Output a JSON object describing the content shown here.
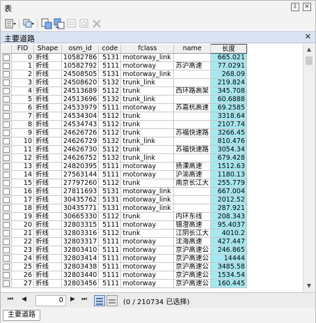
{
  "window": {
    "title": "表"
  },
  "table_tab": {
    "name": "主要道路"
  },
  "columns": [
    "FID",
    "Shape",
    "osm_id",
    "code",
    "fclass",
    "name",
    "长度"
  ],
  "rows": [
    [
      "0",
      "折线",
      "10582786",
      "5131",
      "motorway_link",
      "",
      "665.021"
    ],
    [
      "1",
      "折线",
      "10582792",
      "5111",
      "motorway",
      "苏沪高速",
      "77.0291"
    ],
    [
      "2",
      "折线",
      "24508505",
      "5131",
      "motorway_link",
      "",
      "268.09"
    ],
    [
      "3",
      "折线",
      "24508620",
      "5132",
      "trunk_link",
      "",
      "219.824"
    ],
    [
      "4",
      "折线",
      "24513689",
      "5112",
      "trunk",
      "西环路高架",
      "345.708"
    ],
    [
      "5",
      "折线",
      "24513696",
      "5132",
      "trunk_link",
      "",
      "60.6888"
    ],
    [
      "6",
      "折线",
      "24533979",
      "5111",
      "motorway",
      "苏嘉杭高速",
      "69.2585"
    ],
    [
      "7",
      "折线",
      "24534304",
      "5112",
      "trunk",
      "",
      "3318.64"
    ],
    [
      "8",
      "折线",
      "24534743",
      "5112",
      "trunk",
      "",
      "2107.74"
    ],
    [
      "9",
      "折线",
      "24626726",
      "5112",
      "trunk",
      "苏福快速路",
      "3266.45"
    ],
    [
      "10",
      "折线",
      "24626729",
      "5132",
      "trunk_link",
      "",
      "810.476"
    ],
    [
      "11",
      "折线",
      "24626730",
      "5112",
      "trunk",
      "苏福快速路",
      "3054.34"
    ],
    [
      "12",
      "折线",
      "24626752",
      "5132",
      "trunk_link",
      "",
      "679.428"
    ],
    [
      "13",
      "折线",
      "24820395",
      "5111",
      "motorway",
      "扬溧高速",
      "1512.63"
    ],
    [
      "14",
      "折线",
      "27563144",
      "5111",
      "motorway",
      "沪渝高速",
      "1180.13"
    ],
    [
      "15",
      "折线",
      "27797260",
      "5112",
      "trunk",
      "南京长江大",
      "255.779"
    ],
    [
      "16",
      "折线",
      "27811693",
      "5131",
      "motorway_link",
      "",
      "667.004"
    ],
    [
      "17",
      "折线",
      "30435762",
      "5131",
      "motorway_link",
      "",
      "2012.52"
    ],
    [
      "18",
      "折线",
      "30435771",
      "5131",
      "motorway_link",
      "",
      "287.921"
    ],
    [
      "19",
      "折线",
      "30665330",
      "5112",
      "trunk",
      "内环东线",
      "208.343"
    ],
    [
      "20",
      "折线",
      "32803315",
      "5111",
      "motorway",
      "锡澄高速",
      "95.4037"
    ],
    [
      "21",
      "折线",
      "32803316",
      "5112",
      "trunk",
      "江阴长江大",
      "4010.2"
    ],
    [
      "22",
      "折线",
      "32803317",
      "5111",
      "motorway",
      "沈海高速",
      "427.447"
    ],
    [
      "23",
      "折线",
      "32803410",
      "5111",
      "motorway",
      "京沪高速公",
      "246.865"
    ],
    [
      "24",
      "折线",
      "32803414",
      "5111",
      "motorway",
      "京沪高速公",
      "14444"
    ],
    [
      "25",
      "折线",
      "32803438",
      "5111",
      "motorway",
      "京沪高速公",
      "3485.58"
    ],
    [
      "26",
      "折线",
      "32803440",
      "5111",
      "motorway",
      "京沪高速公",
      "1534.54"
    ],
    [
      "27",
      "折线",
      "32803456",
      "5111",
      "motorway",
      "京沪高速公",
      "160.445"
    ]
  ],
  "status": {
    "record_index": "0",
    "selection_count": "(0 / 210734 已选择)"
  },
  "bottom_tab": {
    "name": "主要道路"
  },
  "icons": {
    "window_controls": [
      "pin-icon",
      "close-icon"
    ],
    "toolbar": [
      "table-options-icon",
      "related-tables-icon",
      "select-by-attributes-icon",
      "switch-selection-icon",
      "clear-selection-icon",
      "zoom-to-selected-icon",
      "delete-selected-icon"
    ]
  }
}
